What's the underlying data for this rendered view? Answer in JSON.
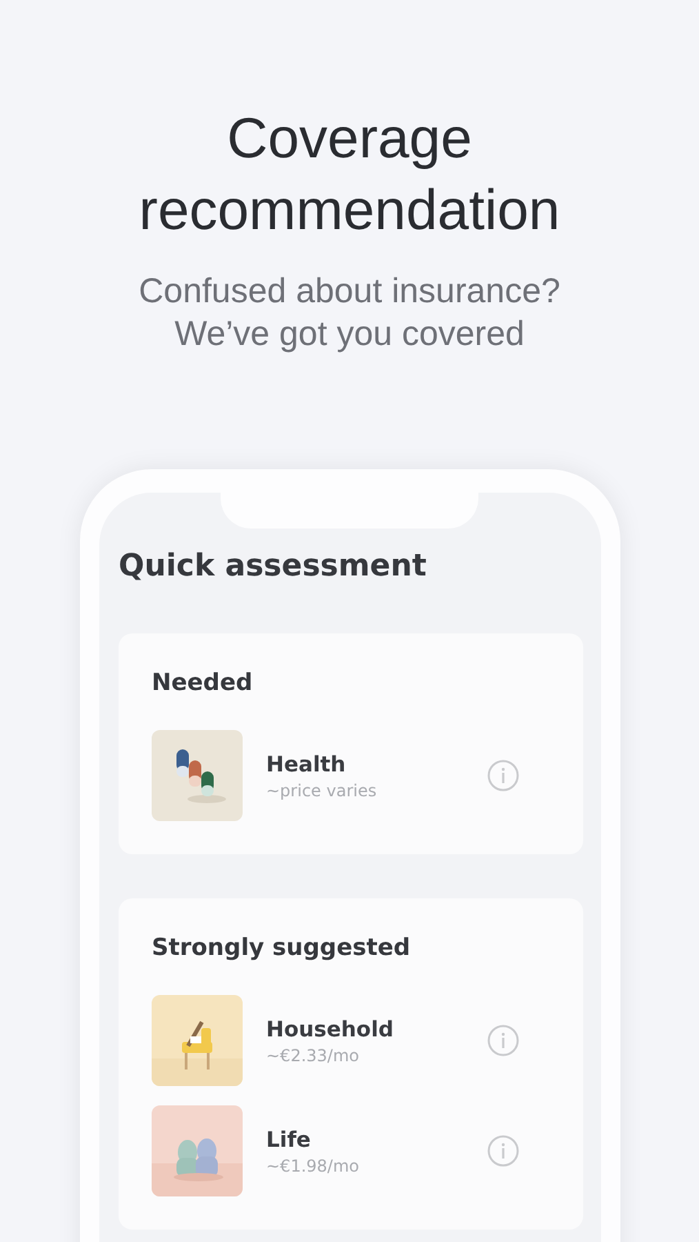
{
  "headline": "Coverage recommendation",
  "subtitle": "Confused about insurance? We’ve got you covered",
  "screen": {
    "title": "Quick assessment",
    "sections": [
      {
        "title": "Needed",
        "items": [
          {
            "name": "Health",
            "price": "~price varies"
          }
        ]
      },
      {
        "title": "Strongly suggested",
        "items": [
          {
            "name": "Household",
            "price": "~€2.33/mo"
          },
          {
            "name": "Life",
            "price": "~€1.98/mo"
          }
        ]
      }
    ]
  }
}
